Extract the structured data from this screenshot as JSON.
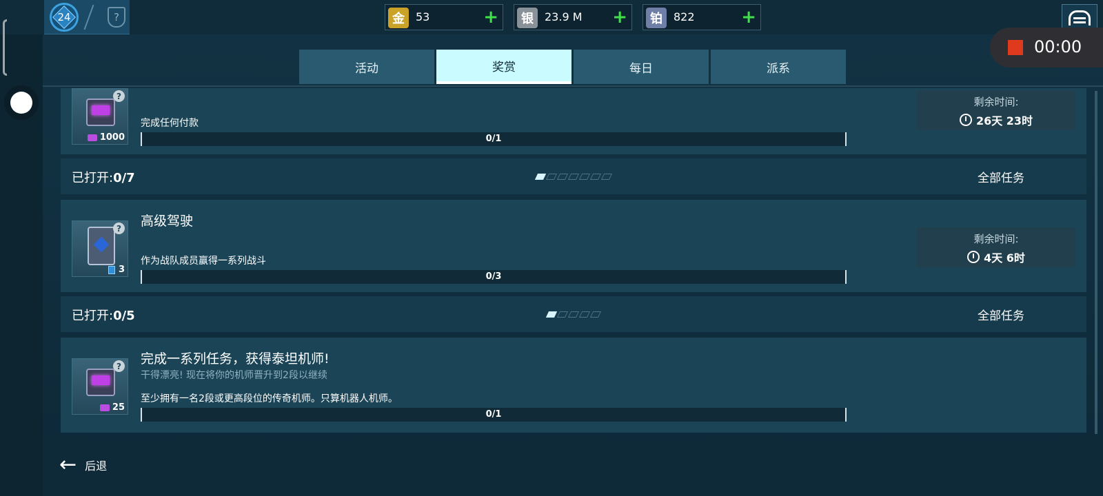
{
  "player": {
    "rank": "24"
  },
  "currencies": [
    {
      "name": "金",
      "value": "53",
      "color": "#c9a227"
    },
    {
      "name": "银",
      "value": "23.9 M",
      "color": "#8a9299"
    },
    {
      "name": "铂",
      "value": "822",
      "color": "#6f7ea6"
    }
  ],
  "recording": {
    "time": "00:00"
  },
  "tabs": [
    {
      "label": "活动",
      "active": false
    },
    {
      "label": "奖赏",
      "active": true
    },
    {
      "label": "每日",
      "active": false
    },
    {
      "label": "派系",
      "active": false
    }
  ],
  "tasks": [
    {
      "description": "完成任何付款",
      "progress": "0/1",
      "reward_count": "1000",
      "time_label": "剩余时间:",
      "time_value": "26天 23时",
      "opened_label": "已打开:",
      "opened_value": "0/7",
      "all_tasks": "全部任务",
      "pips_total": 7,
      "pips_done": 1
    },
    {
      "title": "高级驾驶",
      "description": "作为战队成员赢得一系列战斗",
      "progress": "0/3",
      "reward_count": "3",
      "time_label": "剩余时间:",
      "time_value": "4天 6时",
      "opened_label": "已打开:",
      "opened_value": "0/5",
      "all_tasks": "全部任务",
      "pips_total": 5,
      "pips_done": 1
    },
    {
      "title": "完成一系列任务，获得泰坦机师!",
      "subtitle": "干得漂亮! 现在将你的机师晋升到2段以继续",
      "description": "至少拥有一名2段或更高段位的传奇机师。只算机器人机师。",
      "progress": "0/1",
      "reward_count": "25"
    }
  ],
  "footer": {
    "back_label": "后退"
  }
}
